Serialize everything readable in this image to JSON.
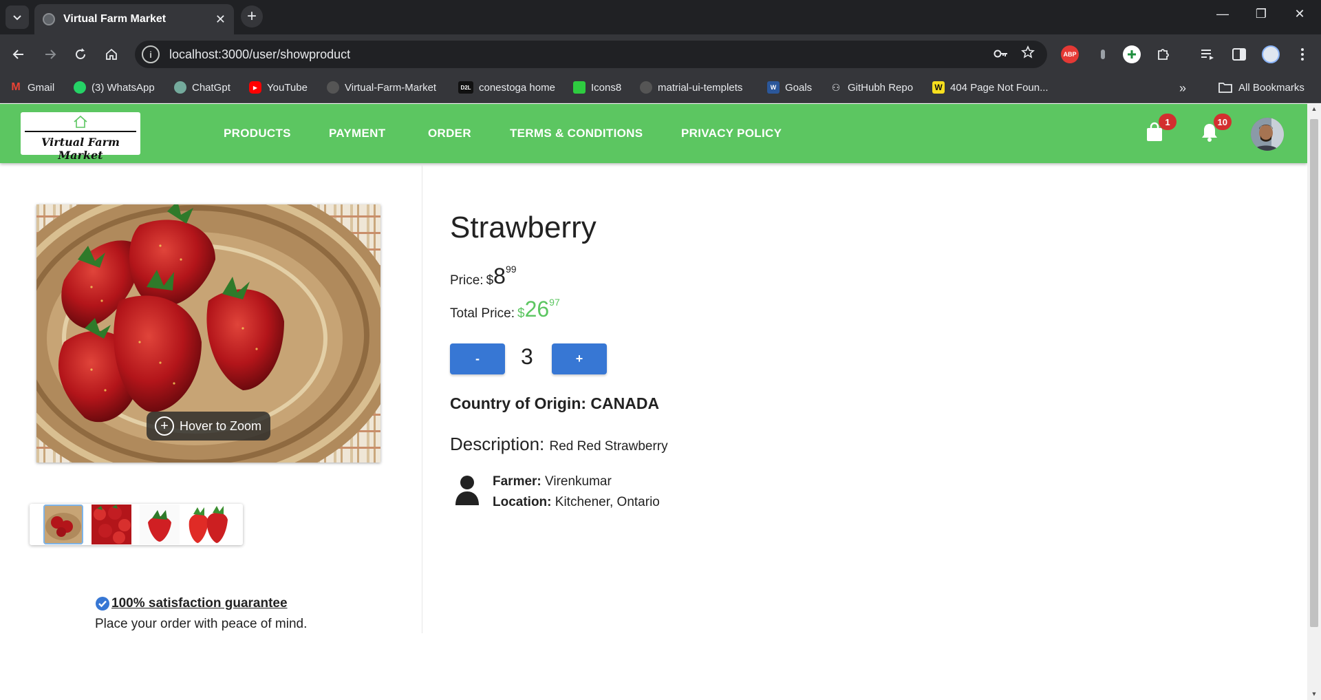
{
  "browser": {
    "tab_title": "Virtual Farm Market",
    "tab_close": "✕",
    "new_tab": "+",
    "url": "localhost:3000/user/showproduct",
    "win_minimize": "—",
    "win_restore": "❐",
    "win_close": "✕",
    "abp_label": "ABP",
    "bookmarks": [
      {
        "label": "Gmail",
        "icon": "gmail-icon",
        "color": "#ea4335"
      },
      {
        "label": "(3) WhatsApp",
        "icon": "whatsapp-icon",
        "color": "#25d366"
      },
      {
        "label": "ChatGpt",
        "icon": "chatgpt-icon",
        "color": "#74aa9c"
      },
      {
        "label": "YouTube",
        "icon": "youtube-icon",
        "color": "#ff0000"
      },
      {
        "label": "Virtual-Farm-Market",
        "icon": "github-icon",
        "color": "#444"
      },
      {
        "label": "conestoga home",
        "icon": "d2l-icon",
        "color": "#111"
      },
      {
        "label": "Icons8",
        "icon": "icons8-icon",
        "color": "#2ecc40"
      },
      {
        "label": "matrial-ui-templets",
        "icon": "github-icon",
        "color": "#444"
      },
      {
        "label": "Goals",
        "icon": "word-icon",
        "color": "#2b579a"
      },
      {
        "label": "GitHubh Repo",
        "icon": "github-repo-icon",
        "color": "#e8eaed"
      },
      {
        "label": "404 Page Not Foun...",
        "icon": "w-icon",
        "color": "#f7df1e"
      }
    ],
    "all_bookmarks": "All Bookmarks"
  },
  "appbar": {
    "logo_text": "Virtual Farm Market",
    "nav": [
      "PRODUCTS",
      "PAYMENT",
      "ORDER",
      "TERMS & CONDITIONS",
      "PRIVACY POLICY"
    ],
    "cart_count": "1",
    "notification_count": "10"
  },
  "product": {
    "name": "Strawberry",
    "zoom_hint": "Hover to Zoom",
    "price_label": "Price:",
    "price_currency": "$",
    "price_whole": "8",
    "price_cents": "99",
    "total_label": "Total Price:",
    "total_currency": "$",
    "total_whole": "26",
    "total_cents": "97",
    "decrement_label": "-",
    "increment_label": "+",
    "quantity": "3",
    "origin": "Country of Origin: CANADA",
    "description_label": "Description:",
    "description": "Red Red Strawberry",
    "farmer_label": "Farmer:",
    "farmer": "Virenkumar",
    "location_label": "Location:",
    "location": "Kitchener, Ontario"
  },
  "guarantee": {
    "title": "100% satisfaction guarantee",
    "subtitle": "Place your order with peace of mind."
  },
  "colors": {
    "appbar": "#5cc661",
    "button": "#3777d4",
    "badge": "#d32f2f",
    "total_price": "#5cc661"
  }
}
